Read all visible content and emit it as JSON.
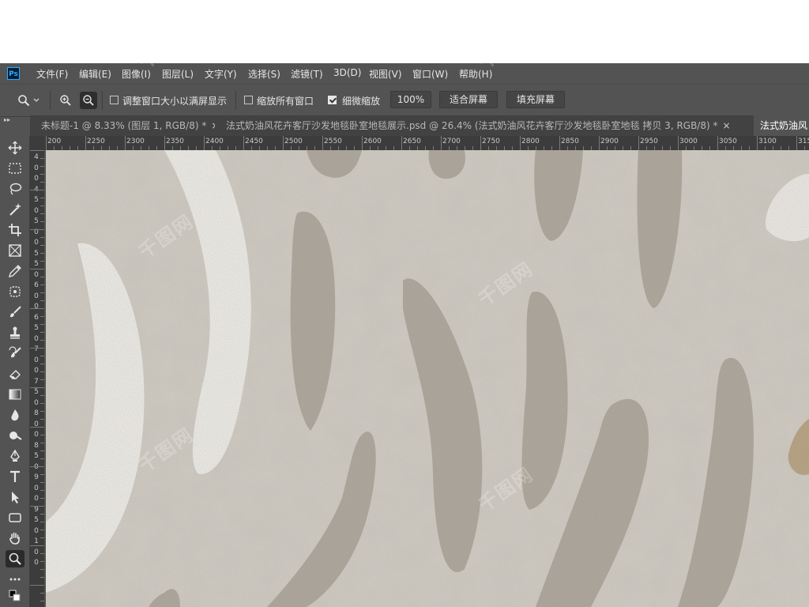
{
  "app": {
    "logo_text": "Ps"
  },
  "menu": {
    "items": [
      "文件(F)",
      "编辑(E)",
      "图像(I)",
      "图层(L)",
      "文字(Y)",
      "选择(S)",
      "滤镜(T)",
      "3D(D)",
      "视图(V)",
      "窗口(W)",
      "帮助(H)"
    ]
  },
  "options": {
    "resize_windows_label": "调整窗口大小以满屏显示",
    "zoom_all_windows_label": "缩放所有窗口",
    "scrubby_zoom_label": "细微缩放",
    "zoom_value": "100%",
    "fit_screen_label": "适合屏幕",
    "fill_screen_label": "填充屏幕",
    "resize_windows_checked": false,
    "zoom_all_windows_checked": false,
    "scrubby_zoom_checked": true
  },
  "tabs": [
    {
      "title": "未标题-1 @ 8.33% (图层 1, RGB/8) *",
      "close": "×"
    },
    {
      "title": "法式奶油风花卉客厅沙发地毯卧室地毯展示.psd @ 26.4% (法式奶油风花卉客厅沙发地毯卧室地毯 拷贝 3, RGB/8) *",
      "close": "×"
    },
    {
      "title": "法式奶油风",
      "close": ""
    }
  ],
  "ruler_top": [
    "200",
    "2250",
    "2300",
    "2350",
    "2400",
    "2450",
    "2500",
    "2550",
    "2600",
    "2650",
    "2700",
    "2750",
    "2800",
    "2850",
    "2900",
    "2950",
    "3000",
    "3050",
    "3100",
    "3150"
  ],
  "ruler_left": [
    "4",
    "0",
    "0",
    "4",
    "5",
    "0",
    "5",
    "0",
    "0",
    "5",
    "5",
    "0",
    "6",
    "0",
    "0",
    "6",
    "5",
    "0",
    "7",
    "0",
    "0",
    "7",
    "5",
    "0",
    "8",
    "0",
    "0",
    "8",
    "5",
    "0",
    "9",
    "0",
    "0",
    "9",
    "5",
    "0",
    "1",
    "0",
    "0"
  ],
  "tools": [
    "move-tool",
    "marquee-tool",
    "lasso-tool",
    "magic-wand-tool",
    "crop-tool",
    "frame-tool",
    "eyedropper-tool",
    "patch-tool",
    "brush-tool",
    "stamp-tool",
    "history-brush-tool",
    "eraser-tool",
    "gradient-tool",
    "blur-tool",
    "dodge-tool",
    "pen-tool",
    "type-tool",
    "path-select-tool",
    "rectangle-tool",
    "hand-tool",
    "zoom-tool",
    "more-tools"
  ],
  "active_tool": "zoom-tool",
  "colors": {
    "ui_dark": "#535353",
    "canvas_bg": "#d3cfc7",
    "stroke_dark": "#a39c91",
    "stroke_white": "#f5f4f0",
    "accent_tan": "#b39b76"
  }
}
